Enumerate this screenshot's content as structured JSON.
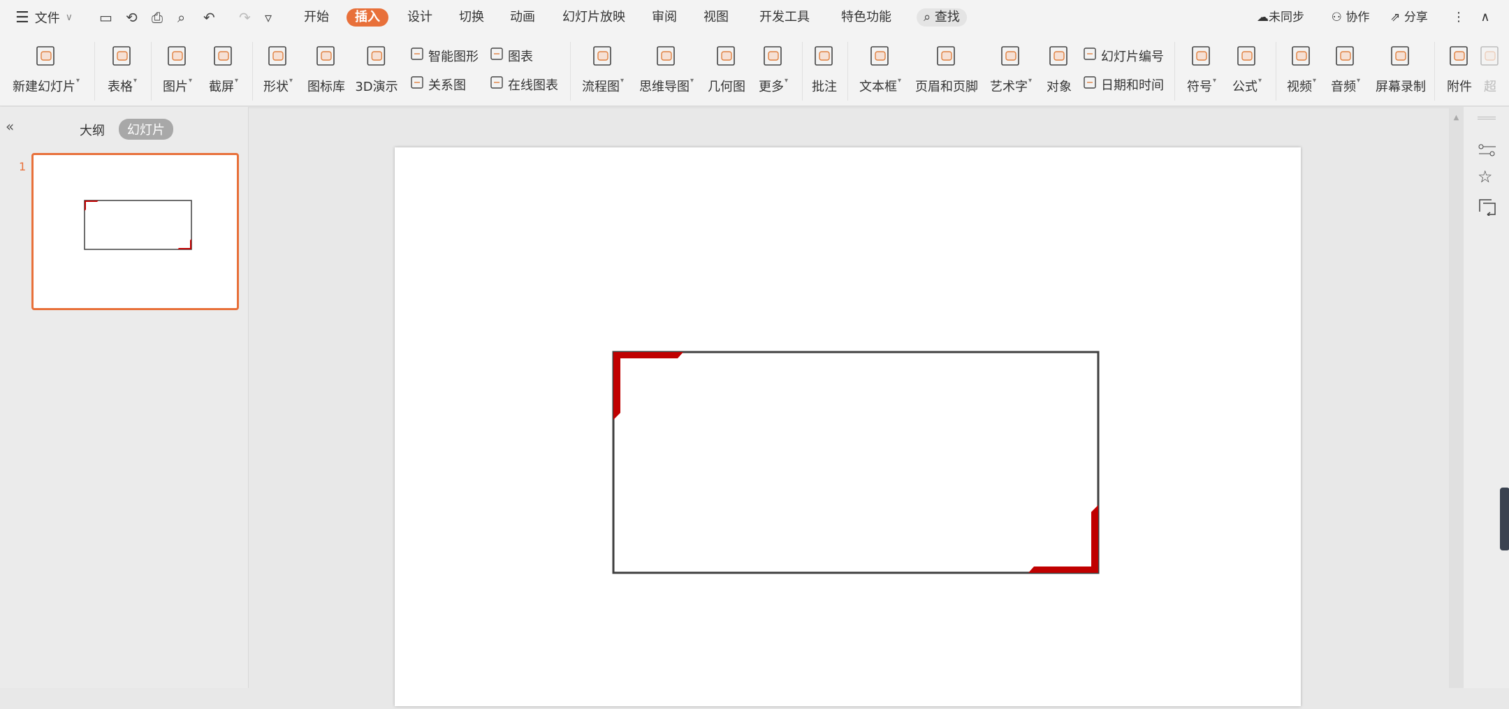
{
  "menu": {
    "file_label": "文件",
    "tabs": [
      "开始",
      "插入",
      "设计",
      "切换",
      "动画",
      "幻灯片放映",
      "审阅",
      "视图",
      "开发工具",
      "特色功能"
    ],
    "active_tab": "插入",
    "find_label": "查找",
    "right": {
      "sync": "未同步",
      "collab": "协作",
      "share": "分享"
    }
  },
  "ribbon": {
    "big": [
      "新建幻灯片",
      "表格",
      "图片",
      "截屏",
      "形状",
      "图标库",
      "3D演示",
      "流程图",
      "思维导图",
      "几何图",
      "更多",
      "批注",
      "文本框",
      "页眉和页脚",
      "艺术字",
      "对象",
      "符号",
      "公式",
      "视频",
      "音频",
      "屏幕录制",
      "附件",
      "超"
    ],
    "small": [
      "智能图形",
      "关系图",
      "图表",
      "在线图表",
      "幻灯片编号",
      "日期和时间"
    ]
  },
  "panel": {
    "outline_tab": "大纲",
    "slides_tab": "幻灯片",
    "slide_number": "1"
  },
  "colors": {
    "accent": "#E8703A",
    "frame_red": "#C00000",
    "frame_border": "#3F3F3F"
  }
}
